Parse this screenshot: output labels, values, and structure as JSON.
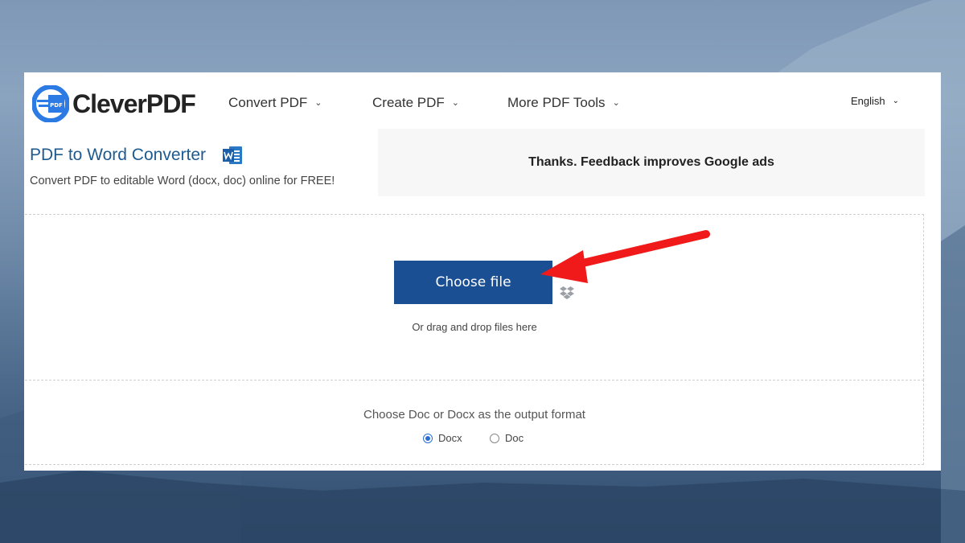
{
  "brand": {
    "name": "CleverPDF",
    "logo_badge": "PDF",
    "accent_color": "#2c7be5"
  },
  "nav": {
    "items": [
      {
        "label": "Convert PDF",
        "icon": "chevron-down-icon"
      },
      {
        "label": "Create PDF",
        "icon": "chevron-down-icon"
      },
      {
        "label": "More PDF Tools",
        "icon": "chevron-down-icon"
      }
    ],
    "language": "English"
  },
  "page": {
    "title": "PDF to Word Converter",
    "title_icon": "word-icon",
    "subtitle": "Convert PDF to editable Word (docx, doc) online for FREE!"
  },
  "ad": {
    "text": "Thanks. Feedback improves Google ads"
  },
  "upload": {
    "button_label": "Choose file",
    "button_color": "#1b4f93",
    "cloud_icon": "dropbox-icon",
    "hint": "Or drag and drop files here"
  },
  "output_format": {
    "label": "Choose Doc or Docx as the output format",
    "options": [
      {
        "label": "Docx",
        "selected": true
      },
      {
        "label": "Doc",
        "selected": false
      }
    ]
  },
  "annotation": {
    "arrow_color": "#f01a1a"
  }
}
